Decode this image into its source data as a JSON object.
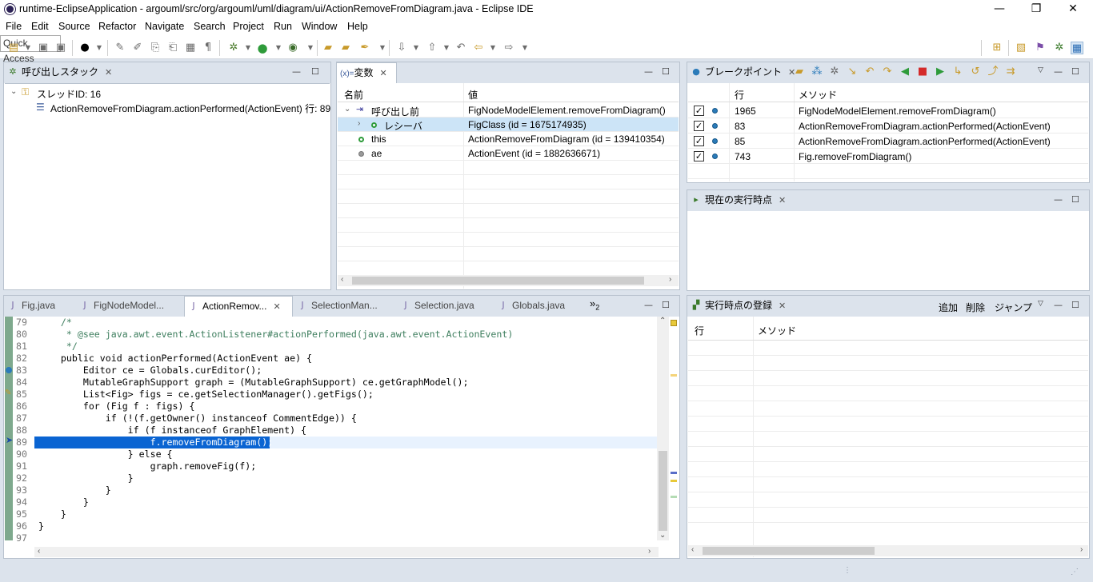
{
  "window": {
    "title": "runtime-EclipseApplication - argouml/src/org/argouml/uml/diagram/ui/ActionRemoveFromDiagram.java - Eclipse IDE",
    "minimize": "—",
    "restore": "❐",
    "close": "✕"
  },
  "menu": [
    "File",
    "Edit",
    "Source",
    "Refactor",
    "Navigate",
    "Search",
    "Project",
    "Run",
    "Window",
    "Help"
  ],
  "toolbar": {
    "quick_access": "Quick Access"
  },
  "callstack": {
    "tab": "呼び出しスタック",
    "thread": "スレッドID: 16",
    "frame": "ActionRemoveFromDiagram.actionPerformed(ActionEvent) 行: 89"
  },
  "variables": {
    "tab": "変数",
    "tab_prefix": "(x)=",
    "col_name": "名前",
    "col_value": "値",
    "rows": [
      {
        "name": "呼び出し前",
        "value": "FigNodeModelElement.removeFromDiagram()"
      },
      {
        "name": "レシーバ",
        "value": "FigClass (id = 1675174935)"
      },
      {
        "name": "this",
        "value": "ActionRemoveFromDiagram (id = 139410354)"
      },
      {
        "name": "ae",
        "value": "ActionEvent (id = 1882636671)"
      }
    ]
  },
  "breakpoints": {
    "tab": "ブレークポイント",
    "col_line": "行",
    "col_method": "メソッド",
    "rows": [
      {
        "line": "1965",
        "method": "FigNodeModelElement.removeFromDiagram()"
      },
      {
        "line": "83",
        "method": "ActionRemoveFromDiagram.actionPerformed(ActionEvent)"
      },
      {
        "line": "85",
        "method": "ActionRemoveFromDiagram.actionPerformed(ActionEvent)"
      },
      {
        "line": "743",
        "method": "Fig.removeFromDiagram()"
      }
    ]
  },
  "current_point": {
    "tab": "現在の実行時点"
  },
  "registered_points": {
    "tab": "実行時点の登録",
    "add": "追加",
    "delete": "削除",
    "jump": "ジャンプ",
    "col_line": "行",
    "col_method": "メソッド"
  },
  "editor": {
    "tabs": [
      {
        "label": "Fig.java"
      },
      {
        "label": "FigNodeModel..."
      },
      {
        "label": "ActionRemov..."
      },
      {
        "label": "SelectionMan..."
      },
      {
        "label": "Selection.java"
      },
      {
        "label": "Globals.java"
      }
    ],
    "overflow": "»",
    "overflow_count": "2",
    "lines": [
      {
        "n": "79",
        "text": "    /*"
      },
      {
        "n": "80",
        "text": "     * @see java.awt.event.ActionListener#actionPerformed(java.awt.event.ActionEvent)"
      },
      {
        "n": "81",
        "text": "     */"
      },
      {
        "n": "82",
        "text": "    public void actionPerformed(ActionEvent ae) {"
      },
      {
        "n": "83",
        "text": "        Editor ce = Globals.curEditor();"
      },
      {
        "n": "84",
        "text": "        MutableGraphSupport graph = (MutableGraphSupport) ce.getGraphModel();"
      },
      {
        "n": "85",
        "text": "        List<Fig> figs = ce.getSelectionManager().getFigs();"
      },
      {
        "n": "86",
        "text": "        for (Fig f : figs) {"
      },
      {
        "n": "87",
        "text": "            if (!(f.getOwner() instanceof CommentEdge)) {"
      },
      {
        "n": "88",
        "text": "                if (f instanceof GraphElement) {"
      },
      {
        "n": "89",
        "text": "                    f.removeFromDiagram();"
      },
      {
        "n": "90",
        "text": "                } else {"
      },
      {
        "n": "91",
        "text": "                    graph.removeFig(f);"
      },
      {
        "n": "92",
        "text": "                }"
      },
      {
        "n": "93",
        "text": "            }"
      },
      {
        "n": "94",
        "text": "        }"
      },
      {
        "n": "95",
        "text": "    }"
      },
      {
        "n": "96",
        "text": "}"
      },
      {
        "n": "97",
        "text": ""
      }
    ]
  }
}
